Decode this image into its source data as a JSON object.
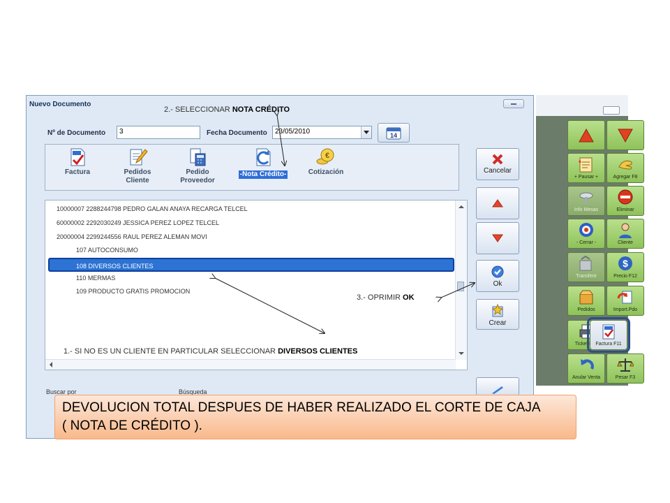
{
  "dialog": {
    "title": "Nuevo Documento",
    "doc_num_label": "Nº de Documento",
    "doc_num_value": "3",
    "date_label": "Fecha Documento",
    "date_value": "23/05/2010",
    "cal_day": "14"
  },
  "doc_types": [
    {
      "label": "Factura",
      "icon": "invoice-icon"
    },
    {
      "label": "Pedidos\nCliente",
      "icon": "edit-document-icon"
    },
    {
      "label": "Pedido\nProveedor",
      "icon": "calculator-document-icon"
    },
    {
      "label": "-Nota Crédito-",
      "icon": "return-document-icon",
      "selected": true
    },
    {
      "label": "Cotización",
      "icon": "euro-coins-icon"
    }
  ],
  "list_rows": [
    "10000007  2288244798  PEDRO GALAN ANAYA RECARGA TELCEL",
    "60000002  2292030249  JESSICA PEREZ LOPEZ   TELCEL",
    "20000004  2299244556  RAUL PEREZ ALEMAN  MOVI",
    "107  AUTOCONSUMO",
    "108  DIVERSOS CLIENTES",
    "110  MERMAS",
    "109  PRODUCTO GRATIS PROMOCION"
  ],
  "buttons": {
    "cancel": "Cancelar",
    "ok": "Ok",
    "create": "Crear"
  },
  "bottom": {
    "search_by": "Buscar por",
    "search": "Búsqueda"
  },
  "toolbar": {
    "tiles": [
      "",
      "",
      "+ Pausar +",
      "Agregar F8",
      "Info Mesas",
      "Eliminar",
      "- Cerrar -",
      "Cliente",
      "Transferir",
      "Precio F12",
      "Pedidos",
      "Import.Pdo",
      "Ticket F10",
      "Factura F11",
      "Anular Venta",
      "Pesar F3"
    ]
  },
  "annotations": {
    "step2_prefix": "2.-  SELECCIONAR ",
    "step2_bold": "NOTA CRÉDITO",
    "step3_prefix": "3.-  OPRIMIR ",
    "step3_bold": "OK",
    "step1_prefix": "1.-  SI NO ES UN CLIENTE EN PARTICULAR SELECCIONAR ",
    "step1_bold": "DIVERSOS CLIENTES"
  },
  "banner": {
    "line1": "DEVOLUCION TOTAL DESPUES DE HABER REALIZADO EL CORTE DE CAJA",
    "line2": " ( NOTA DE CRÉDITO )."
  },
  "colors": {
    "selection": "#2c73d3",
    "tile_green": "#9fd16a",
    "banner_orange": "#f9b98b"
  }
}
